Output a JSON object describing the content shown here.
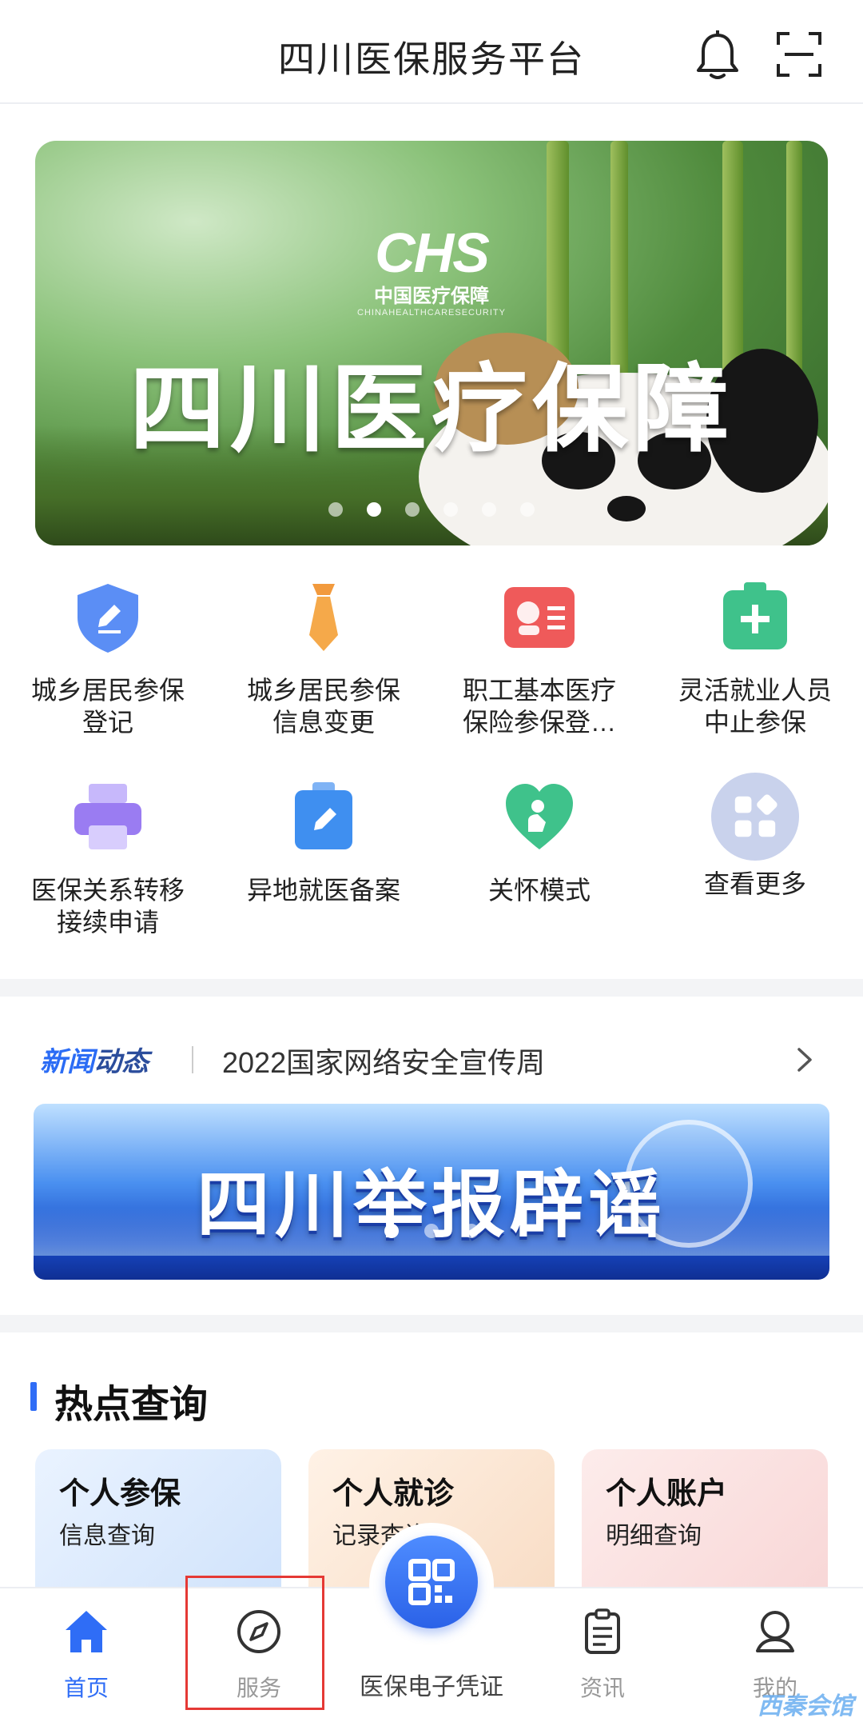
{
  "header": {
    "title": "四川医保服务平台",
    "icons": [
      "bell-icon",
      "scan-icon"
    ]
  },
  "banner": {
    "logo_mark": "CHS",
    "logo_cn": "中国医疗保障",
    "logo_en": "CHINAHEALTHCARESECURITY",
    "headline": "四川医疗保障",
    "slide_count": 6,
    "active_slide": 1
  },
  "services": [
    {
      "label": "城乡居民参保\n登记",
      "icon": "shield-edit-icon",
      "color": "#5b8ef5"
    },
    {
      "label": "城乡居民参保\n信息变更",
      "icon": "tie-icon",
      "color": "#f29a3d"
    },
    {
      "label": "职工基本医疗\n保险参保登…",
      "icon": "id-card-icon",
      "color": "#ef5a5a"
    },
    {
      "label": "灵活就业人员\n中止参保",
      "icon": "medical-kit-icon",
      "color": "#3fc28b"
    },
    {
      "label": "医保关系转移\n接续申请",
      "icon": "printer-icon",
      "color": "#9a7cf2"
    },
    {
      "label": "异地就医备案",
      "icon": "clipboard-edit-icon",
      "color": "#3f8ff0"
    },
    {
      "label": "关怀模式",
      "icon": "heart-care-icon",
      "color": "#3fc28b"
    },
    {
      "label": "查看更多",
      "icon": "more-apps-icon",
      "color": "#9fb0d8"
    }
  ],
  "news": {
    "tag_part1": "新闻",
    "tag_part2": "动态",
    "headline": "2022国家网络安全宣传周",
    "banner_text": "四川举报辟谣",
    "slide_count": 3,
    "active_slide": 0
  },
  "hot": {
    "title": "热点查询",
    "cards": [
      {
        "title": "个人参保",
        "subtitle": "信息查询"
      },
      {
        "title": "个人就诊",
        "subtitle": "记录查询"
      },
      {
        "title": "个人账户",
        "subtitle": "明细查询"
      }
    ]
  },
  "tabbar": {
    "tabs": [
      {
        "label": "首页",
        "icon": "home-icon",
        "active": true
      },
      {
        "label": "服务",
        "icon": "compass-icon",
        "active": false
      },
      {
        "label": "医保电子凭证",
        "icon": "qr-code-icon",
        "active": false
      },
      {
        "label": "资讯",
        "icon": "clipboard-icon",
        "active": false
      },
      {
        "label": "我的",
        "icon": "user-icon",
        "active": false
      }
    ]
  },
  "watermark": "西秦会馆",
  "colors": {
    "accent": "#2f6df6",
    "highlight": "#e53935"
  }
}
